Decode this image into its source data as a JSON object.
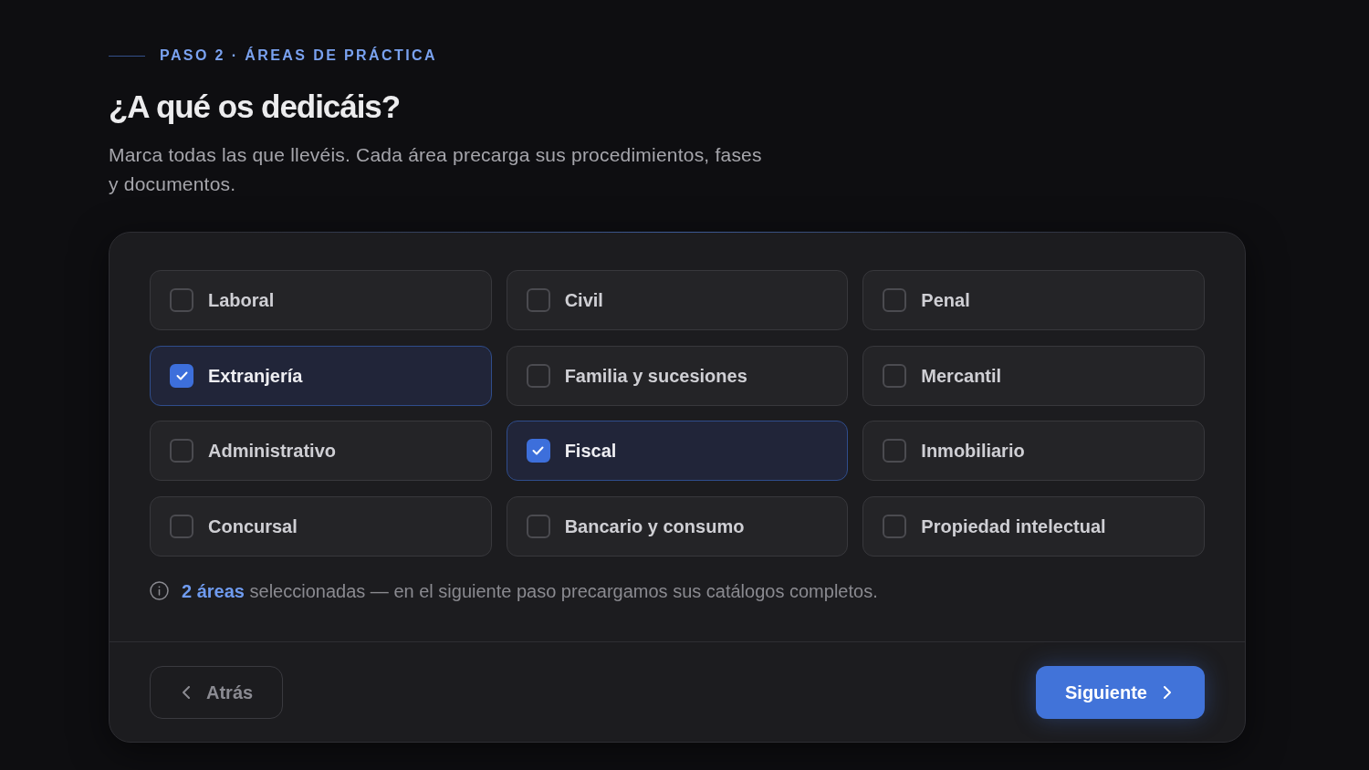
{
  "step": {
    "label": "PASO 2 · ÁREAS DE PRÁCTICA"
  },
  "heading": "¿A qué os dedicáis?",
  "description": "Marca todas las que llevéis. Cada área precarga sus procedimientos, fases y documentos.",
  "areas": [
    {
      "label": "Laboral",
      "checked": false
    },
    {
      "label": "Civil",
      "checked": false
    },
    {
      "label": "Penal",
      "checked": false
    },
    {
      "label": "Extranjería",
      "checked": true
    },
    {
      "label": "Familia y sucesiones",
      "checked": false
    },
    {
      "label": "Mercantil",
      "checked": false
    },
    {
      "label": "Administrativo",
      "checked": false
    },
    {
      "label": "Fiscal",
      "checked": true
    },
    {
      "label": "Inmobiliario",
      "checked": false
    },
    {
      "label": "Concursal",
      "checked": false
    },
    {
      "label": "Bancario y consumo",
      "checked": false
    },
    {
      "label": "Propiedad intelectual",
      "checked": false
    }
  ],
  "summary": "**2 áreas** seleccionadas — en el siguiente paso precargamos sus catálogos completos.",
  "buttons": {
    "back": "Atrás",
    "next": "Siguiente"
  }
}
